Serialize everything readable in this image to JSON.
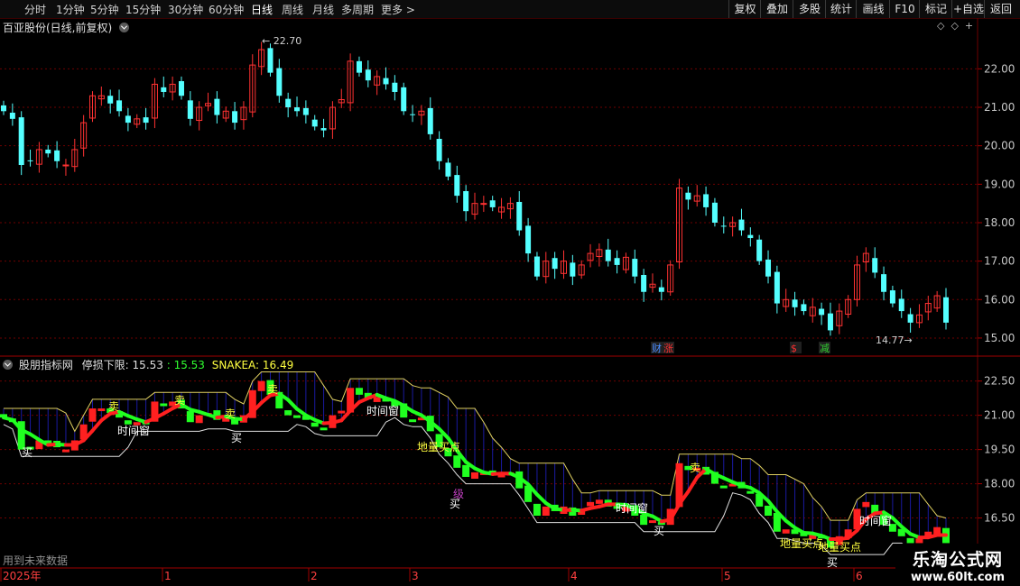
{
  "toolbar": {
    "periods": [
      "分时",
      "1分钟",
      "5分钟",
      "15分钟",
      "30分钟",
      "60分钟",
      "日线",
      "周线",
      "月线",
      "多周期",
      "更多 >"
    ],
    "active_period": "日线",
    "right_buttons": [
      "复权",
      "叠加",
      "多股",
      "统计",
      "画线",
      "F10",
      "标记",
      "+自选",
      "返回"
    ]
  },
  "main_panel": {
    "title": "百亚股份(日线,前复权)",
    "high_label": "22.70",
    "low_label": "14.77",
    "y_ticks": [
      "22.00",
      "21.00",
      "20.00",
      "19.00",
      "18.00",
      "17.00",
      "16.00",
      "15.00"
    ],
    "markers": [
      {
        "text": "财",
        "color": "#4a8cff"
      },
      {
        "text": "涨",
        "color": "#ff3030"
      },
      {
        "text": "$",
        "color": "#ff3030"
      },
      {
        "text": "减",
        "color": "#30d030"
      }
    ]
  },
  "indicator_panel": {
    "name": "股朋指标网",
    "param1_label": "停损下限:",
    "param1_value": "15.53",
    "param2_value": ": 15.53",
    "param3_label": "SNAKEA:",
    "param3_value": "16.49",
    "y_ticks": [
      "22.50",
      "21.00",
      "19.50",
      "18.00",
      "16.50"
    ],
    "annotations": [
      "卖",
      "卖",
      "卖",
      "卖",
      "卖",
      "买",
      "买",
      "买",
      "买",
      "买",
      "时间窗",
      "时间窗",
      "时间窗",
      "时间窗",
      "地量买点",
      "地量买点",
      "地量买点",
      "级"
    ],
    "footer_note": "用到未来数据"
  },
  "time_axis": {
    "labels": [
      "2025年",
      "1",
      "2",
      "3",
      "4",
      "5",
      "6"
    ]
  },
  "watermark": {
    "title": "乐淘公式网",
    "url": "www.60lt.com"
  },
  "colors": {
    "up": "#ff3232",
    "down": "#54ffff",
    "snake_up": "#ff2020",
    "snake_down": "#20ff20",
    "grid": "#6e0000",
    "band": "#1a1aa0"
  },
  "chart_data": {
    "type": "candlestick",
    "y_range_price": [
      14.6,
      22.9
    ],
    "y_range_indicator": [
      15.1,
      23.0
    ],
    "closes": [
      20.9,
      20.7,
      19.5,
      19.6,
      19.9,
      19.8,
      19.6,
      19.5,
      19.9,
      20.6,
      21.3,
      21.3,
      21.1,
      20.9,
      20.6,
      20.7,
      20.6,
      21.6,
      21.4,
      21.6,
      21.3,
      20.7,
      21.0,
      21.1,
      20.8,
      20.9,
      20.6,
      21.0,
      22.1,
      22.5,
      21.9,
      21.3,
      21.0,
      20.9,
      20.8,
      20.5,
      20.4,
      21.0,
      21.2,
      22.2,
      21.9,
      21.7,
      21.8,
      21.6,
      21.4,
      20.9,
      20.8,
      20.9,
      20.3,
      19.6,
      19.2,
      18.7,
      18.3,
      18.5,
      18.5,
      18.4,
      18.4,
      18.5,
      17.8,
      17.2,
      16.6,
      17.0,
      16.8,
      17.0,
      16.6,
      16.9,
      17.2,
      17.3,
      17.0,
      16.9,
      17.1,
      16.6,
      16.2,
      16.4,
      16.2,
      16.9,
      18.9,
      18.6,
      18.7,
      18.4,
      18.0,
      17.9,
      18.0,
      17.8,
      17.6,
      17.0,
      16.6,
      15.9,
      16.0,
      15.8,
      15.7,
      15.8,
      15.6,
      15.2,
      15.7,
      16.0,
      16.9,
      17.2,
      16.7,
      16.2,
      15.9,
      15.7,
      15.4,
      15.6,
      15.9,
      16.1,
      15.4
    ],
    "ylabel": "",
    "xlabel": ""
  }
}
